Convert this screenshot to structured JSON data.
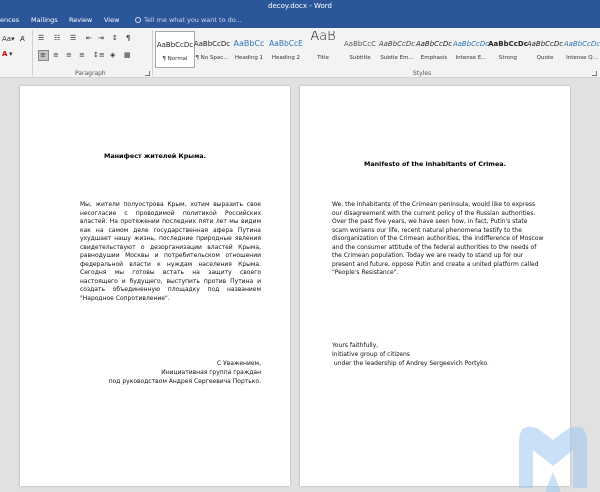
{
  "window": {
    "title": "decoy.docx - Word"
  },
  "tabs": {
    "references": "ences",
    "mailings": "Mailings",
    "review": "Review",
    "view": "View",
    "tell_me": "Tell me what you want to do..."
  },
  "ribbon": {
    "font_size_label": "Aa",
    "paragraph_mark": "¶",
    "paragraph_group": "Paragraph",
    "styles_group": "Styles",
    "styles": [
      {
        "sample": "AaBbCcDc",
        "name": "¶ Normal",
        "size": "7px",
        "active": true
      },
      {
        "sample": "AaBbCcDc",
        "name": "¶ No Spac...",
        "size": "7px"
      },
      {
        "sample": "AaBbCc",
        "name": "Heading 1",
        "size": "8px",
        "color": "#2e74b5"
      },
      {
        "sample": "AaBbCcE",
        "name": "Heading 2",
        "size": "7.5px",
        "color": "#2e74b5"
      },
      {
        "sample": "AaB",
        "name": "Title",
        "size": "13px"
      },
      {
        "sample": "AaBbCcC",
        "name": "Subtitle",
        "size": "7px",
        "color": "#5a5a5a"
      },
      {
        "sample": "AaBbCcDc",
        "name": "Subtle Em...",
        "size": "7px",
        "color": "#444",
        "italic": true
      },
      {
        "sample": "AaBbCcDc",
        "name": "Emphasis",
        "size": "7px",
        "italic": true
      },
      {
        "sample": "AaBbCcDc",
        "name": "Intense E...",
        "size": "7px",
        "color": "#2e74b5",
        "italic": true
      },
      {
        "sample": "AaBbCcDc",
        "name": "Strong",
        "size": "7px",
        "bold": true
      },
      {
        "sample": "AaBbCcDc",
        "name": "Quote",
        "size": "7px",
        "italic": true
      },
      {
        "sample": "AaBbCcDc",
        "name": "Intense Q...",
        "size": "7px",
        "color": "#2e74b5",
        "italic": true
      }
    ]
  },
  "page1": {
    "title": "Манифест жителей Крыма.",
    "body": "Мы, жители полуострова Крым, хотим выразить свое несогласие с проводимой политикой Российских властей. На протяжении последних пяти лет мы видим как на самом деле государственная афера Путина ухудшает нашу жизнь, последние природные явления свидетельствуют о дезорганизации властей Крыма, равнодушии Москвы и потребительском отношении федеральной власти к нуждам населения Крыма. Сегодня мы готовы встать на защиту своего настоящего и будущего, выступить против Путина и создать объединенную площадку под названием \"Народное Сопротивление\".",
    "sign_lines": [
      "С Уважением,",
      "Инициативная группа граждан",
      "под руководством Андрея Сергеевича Портько."
    ]
  },
  "page2": {
    "title": "Manifesto of the inhabitants of Crimea.",
    "body": "We, the inhabitants of the Crimean peninsula, would like to express our disagreement with the current policy of the Russian authorities. Over the past five years, we have seen how, in fact, Putin's state scam worsens our life, recent natural phenomena testify to the disorganization of the Crimean authorities, the indifference of Moscow and the consumer attitude of the federal authorities to the needs of the Crimean population. Today we are ready to stand up for our present and future, oppose Putin and create a united platform called \"People's Resistance\".",
    "sign_lines": [
      "Yours faithfully,",
      "Initiative group of citizens",
      " under the leadership of Andrey Sergeevich Portyko."
    ]
  }
}
